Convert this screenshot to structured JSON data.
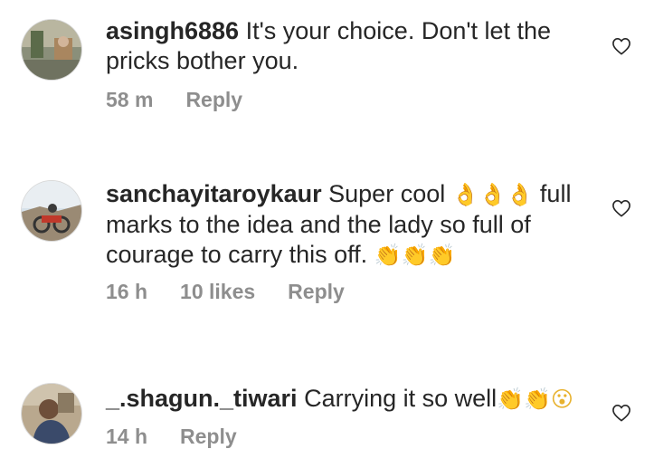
{
  "comments": [
    {
      "username": "asingh6886",
      "text": "It's your choice. Don't let the pricks bother you.",
      "time": "58 m",
      "reply_label": "Reply",
      "heart_icon": "heart-outline-icon"
    },
    {
      "username": "sanchayitaroykaur",
      "text_a": "Super cool",
      "emojis_a": "👌👌👌",
      "text_b": "full marks to the idea and the lady so full of courage to carry this off.",
      "emojis_b": "👏👏👏",
      "time": "16 h",
      "likes": "10 likes",
      "reply_label": "Reply",
      "heart_icon": "heart-outline-icon"
    },
    {
      "username": "_.shagun._tiwari",
      "text": "Carrying it so well",
      "emojis": "👏👏😮",
      "time": "14 h",
      "reply_label": "Reply",
      "heart_icon": "heart-outline-icon"
    }
  ],
  "colors": {
    "text": "#262626",
    "meta": "#8e8e8e",
    "background": "#ffffff"
  }
}
